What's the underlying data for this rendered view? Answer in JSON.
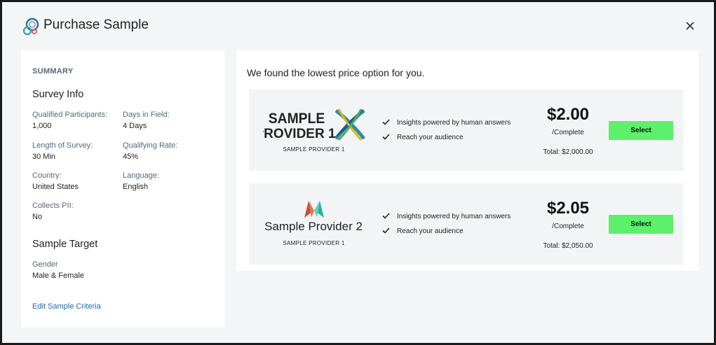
{
  "header": {
    "title": "Purchase Sample"
  },
  "summary": {
    "heading": "SUMMARY",
    "survey_info_title": "Survey Info",
    "fields": [
      {
        "label": "Qualified Participants:",
        "value": "1,000"
      },
      {
        "label": "Days in Field:",
        "value": "4 Days"
      },
      {
        "label": "Length of Survey:",
        "value": "30 Min"
      },
      {
        "label": "Qualifying Rate:",
        "value": "45%"
      },
      {
        "label": "Country:",
        "value": "United States"
      },
      {
        "label": "Language:",
        "value": "English"
      },
      {
        "label": "Collects PII:",
        "value": "No"
      }
    ],
    "sample_target_title": "Sample Target",
    "target": {
      "label": "Gender",
      "value": "Male & Female"
    },
    "edit_link": "Edit Sample Criteria"
  },
  "main": {
    "heading": "We found the lowest price option for you.",
    "providers": [
      {
        "logo_line1": "SAMPLE",
        "logo_line2": "PROVIDER 1",
        "caption": "SAMPLE PROVIDER 1",
        "features": [
          "Insights powered by human answers",
          "Reach your audience"
        ],
        "price": "$2.00",
        "unit": "/Complete",
        "total": "Total: $2,000.00",
        "select_label": "Select"
      },
      {
        "logo_text": "Sample Provider 2",
        "caption": "SAMPLE PROVIDER 1",
        "features": [
          "Insights powered by human answers",
          "Reach your audience"
        ],
        "price": "$2.05",
        "unit": "/Complete",
        "total": "Total: $2,050.00",
        "select_label": "Select"
      }
    ]
  },
  "colors": {
    "select_button": "#5cf06c",
    "link": "#1f6aa5",
    "label": "#5a6778",
    "card_bg": "#f3f4f6",
    "page_bg": "#f4f5f7"
  }
}
